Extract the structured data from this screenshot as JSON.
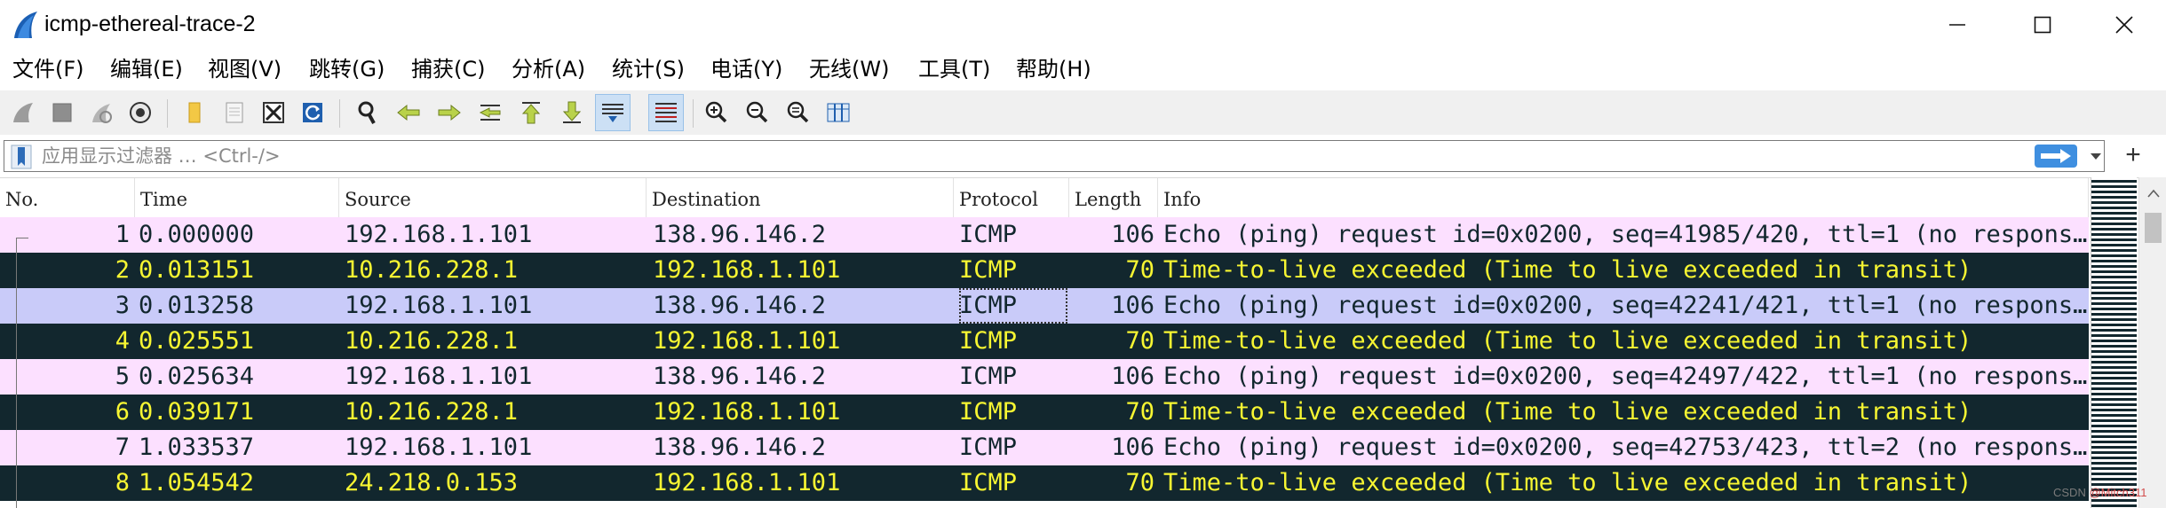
{
  "window": {
    "title": "icmp-ethereal-trace-2",
    "app_icon": "wireshark-fin-icon",
    "controls": [
      "minimize-icon",
      "maximize-icon",
      "close-icon"
    ]
  },
  "menu": [
    {
      "label": "文件(F)"
    },
    {
      "label": "编辑(E)"
    },
    {
      "label": "视图(V)"
    },
    {
      "label": "跳转(G)"
    },
    {
      "label": "捕获(C)"
    },
    {
      "label": "分析(A)"
    },
    {
      "label": "统计(S)"
    },
    {
      "label": "电话(Y)"
    },
    {
      "label": "无线(W)"
    },
    {
      "label": "工具(T)"
    },
    {
      "label": "帮助(H)"
    }
  ],
  "toolbar": {
    "buttons": [
      "start-capture-icon",
      "stop-capture-icon",
      "restart-capture-icon",
      "capture-options-icon",
      "open-file-icon",
      "save-file-icon",
      "close-file-icon",
      "reload-file-icon",
      "find-packet-icon",
      "go-back-icon",
      "go-forward-icon",
      "go-to-packet-icon",
      "first-packet-icon",
      "last-packet-icon",
      "autoscroll-icon",
      "colorize-icon",
      "zoom-in-icon",
      "zoom-out-icon",
      "normal-size-icon",
      "resize-columns-icon"
    ],
    "active": [
      "autoscroll-icon",
      "colorize-icon"
    ]
  },
  "filter": {
    "placeholder": "应用显示过滤器 … <Ctrl-/>",
    "value": "",
    "add_label": "+"
  },
  "packet_list": {
    "columns": [
      "No.",
      "Time",
      "Source",
      "Destination",
      "Protocol",
      "Length",
      "Info"
    ],
    "rows": [
      {
        "no": "1",
        "time": "0.000000",
        "source": "192.168.1.101",
        "destination": "138.96.146.2",
        "protocol": "ICMP",
        "length": "106",
        "info": "Echo (ping) request  id=0x0200, seq=41985/420, ttl=1 (no response found!)",
        "style": "req"
      },
      {
        "no": "2",
        "time": "0.013151",
        "source": "10.216.228.1",
        "destination": "192.168.1.101",
        "protocol": "ICMP",
        "length": "70",
        "info": "Time-to-live exceeded (Time to live exceeded in transit)",
        "style": "ttl"
      },
      {
        "no": "3",
        "time": "0.013258",
        "source": "192.168.1.101",
        "destination": "138.96.146.2",
        "protocol": "ICMP",
        "length": "106",
        "info": "Echo (ping) request  id=0x0200, seq=42241/421, ttl=1 (no response found!)",
        "style": "sel"
      },
      {
        "no": "4",
        "time": "0.025551",
        "source": "10.216.228.1",
        "destination": "192.168.1.101",
        "protocol": "ICMP",
        "length": "70",
        "info": "Time-to-live exceeded (Time to live exceeded in transit)",
        "style": "ttl"
      },
      {
        "no": "5",
        "time": "0.025634",
        "source": "192.168.1.101",
        "destination": "138.96.146.2",
        "protocol": "ICMP",
        "length": "106",
        "info": "Echo (ping) request  id=0x0200, seq=42497/422, ttl=1 (no response found!)",
        "style": "req"
      },
      {
        "no": "6",
        "time": "0.039171",
        "source": "10.216.228.1",
        "destination": "192.168.1.101",
        "protocol": "ICMP",
        "length": "70",
        "info": "Time-to-live exceeded (Time to live exceeded in transit)",
        "style": "ttl"
      },
      {
        "no": "7",
        "time": "1.033537",
        "source": "192.168.1.101",
        "destination": "138.96.146.2",
        "protocol": "ICMP",
        "length": "106",
        "info": "Echo (ping) request  id=0x0200, seq=42753/423, ttl=2 (no response found!)",
        "style": "req"
      },
      {
        "no": "8",
        "time": "1.054542",
        "source": "24.218.0.153",
        "destination": "192.168.1.101",
        "protocol": "ICMP",
        "length": "70",
        "info": "Time-to-live exceeded (Time to live exceeded in transit)",
        "style": "ttl"
      }
    ]
  },
  "colors": {
    "request_bg": "#fce0ff",
    "ttl_bg": "#12272e",
    "ttl_fg": "#f7f632",
    "selected_bg": "#c9cbf9",
    "accent": "#3f8fe0"
  },
  "watermark": {
    "prefix": "CSDN ",
    "handle": "@Mitch311"
  }
}
